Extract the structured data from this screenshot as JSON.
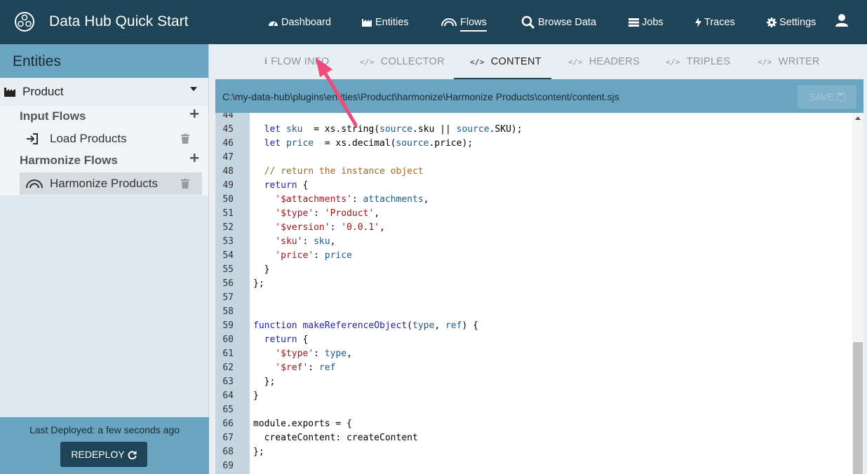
{
  "app": {
    "title": "Data Hub Quick Start"
  },
  "nav": [
    {
      "label": "Dashboard",
      "icon": "dashboard-icon"
    },
    {
      "label": "Entities",
      "icon": "entities-icon"
    },
    {
      "label": "Flows",
      "icon": "flows-icon",
      "active": true
    },
    {
      "label": "Browse Data",
      "icon": "search-icon"
    },
    {
      "label": "Jobs",
      "icon": "jobs-icon"
    },
    {
      "label": "Traces",
      "icon": "bolt-icon"
    },
    {
      "label": "Settings",
      "icon": "gear-icon"
    }
  ],
  "sidebar": {
    "title": "Entities",
    "entity": {
      "label": "Product",
      "icon": "factory-icon",
      "expanded": true
    },
    "input_flows_label": "Input Flows",
    "input_flows": [
      {
        "label": "Load Products",
        "icon": "sign-in-icon"
      }
    ],
    "harmonize_flows_label": "Harmonize Flows",
    "harmonize_flows": [
      {
        "label": "Harmonize Products",
        "icon": "rainbow-icon",
        "selected": true
      }
    ],
    "last_deployed": "Last Deployed: a few seconds ago",
    "redeploy_label": "REDEPLOY"
  },
  "tabs": [
    {
      "label": "FLOW INFO",
      "icon": "info-icon"
    },
    {
      "label": "COLLECTOR",
      "icon": "code-icon"
    },
    {
      "label": "CONTENT",
      "icon": "code-icon",
      "active": true
    },
    {
      "label": "HEADERS",
      "icon": "code-icon"
    },
    {
      "label": "TRIPLES",
      "icon": "code-icon"
    },
    {
      "label": "WRITER",
      "icon": "code-icon"
    }
  ],
  "editor": {
    "path": "C:\\my-data-hub\\plugins\\entities\\Product\\harmonize\\Harmonize Products\\content/content.sjs",
    "save_label": "SAVE",
    "save_disabled": true,
    "lines": [
      {
        "n": "44",
        "tokens": []
      },
      {
        "n": "45",
        "tokens": [
          [
            "kw",
            "  let "
          ],
          [
            "var",
            "sku"
          ],
          [
            "",
            "  = xs.string("
          ],
          [
            "var",
            "source"
          ],
          [
            "",
            ".sku || "
          ],
          [
            "var",
            "source"
          ],
          [
            "",
            ".SKU);"
          ]
        ]
      },
      {
        "n": "46",
        "tokens": [
          [
            "kw",
            "  let "
          ],
          [
            "var",
            "price"
          ],
          [
            "",
            "  = xs.decimal("
          ],
          [
            "var",
            "source"
          ],
          [
            "",
            ".price);"
          ]
        ]
      },
      {
        "n": "47",
        "tokens": []
      },
      {
        "n": "48",
        "tokens": [
          [
            "cmt",
            "  // return the instance object"
          ]
        ]
      },
      {
        "n": "49",
        "tokens": [
          [
            "kw",
            "  return"
          ],
          [
            "",
            " {"
          ]
        ]
      },
      {
        "n": "50",
        "tokens": [
          [
            "str",
            "    '$attachments'"
          ],
          [
            "",
            ": "
          ],
          [
            "var",
            "attachments"
          ],
          [
            "",
            ","
          ]
        ]
      },
      {
        "n": "51",
        "tokens": [
          [
            "str",
            "    '$type'"
          ],
          [
            "",
            ": "
          ],
          [
            "str",
            "'Product'"
          ],
          [
            "",
            ","
          ]
        ]
      },
      {
        "n": "52",
        "tokens": [
          [
            "str",
            "    '$version'"
          ],
          [
            "",
            ": "
          ],
          [
            "str",
            "'0.0.1'"
          ],
          [
            "",
            ","
          ]
        ]
      },
      {
        "n": "53",
        "tokens": [
          [
            "str",
            "    'sku'"
          ],
          [
            "",
            ": "
          ],
          [
            "var",
            "sku"
          ],
          [
            "",
            ","
          ]
        ]
      },
      {
        "n": "54",
        "tokens": [
          [
            "str",
            "    'price'"
          ],
          [
            "",
            ": "
          ],
          [
            "var",
            "price"
          ]
        ]
      },
      {
        "n": "55",
        "tokens": [
          [
            "",
            "  }"
          ]
        ]
      },
      {
        "n": "56",
        "tokens": [
          [
            "",
            "};"
          ]
        ]
      },
      {
        "n": "57",
        "tokens": []
      },
      {
        "n": "58",
        "tokens": []
      },
      {
        "n": "59",
        "tokens": [
          [
            "kw",
            "function "
          ],
          [
            "kw",
            "makeReferenceObject"
          ],
          [
            "",
            "("
          ],
          [
            "var",
            "type"
          ],
          [
            "",
            ", "
          ],
          [
            "var",
            "ref"
          ],
          [
            "",
            ") {"
          ]
        ]
      },
      {
        "n": "60",
        "tokens": [
          [
            "kw",
            "  return"
          ],
          [
            "",
            " {"
          ]
        ]
      },
      {
        "n": "61",
        "tokens": [
          [
            "str",
            "    '$type'"
          ],
          [
            "",
            ": "
          ],
          [
            "var",
            "type"
          ],
          [
            "",
            ","
          ]
        ]
      },
      {
        "n": "62",
        "tokens": [
          [
            "str",
            "    '$ref'"
          ],
          [
            "",
            ": "
          ],
          [
            "var",
            "ref"
          ]
        ]
      },
      {
        "n": "63",
        "tokens": [
          [
            "",
            "  };"
          ]
        ]
      },
      {
        "n": "64",
        "tokens": [
          [
            "",
            "}"
          ]
        ]
      },
      {
        "n": "65",
        "tokens": []
      },
      {
        "n": "66",
        "tokens": [
          [
            "",
            "module.exports = {"
          ]
        ]
      },
      {
        "n": "67",
        "tokens": [
          [
            "",
            "  createContent: createContent"
          ]
        ]
      },
      {
        "n": "68",
        "tokens": [
          [
            "",
            "};"
          ]
        ]
      },
      {
        "n": "69",
        "tokens": []
      }
    ]
  },
  "colors": {
    "topbar": "#1f4457",
    "accent": "#69a4c1",
    "annotation_arrow": "#ee4b7a"
  }
}
